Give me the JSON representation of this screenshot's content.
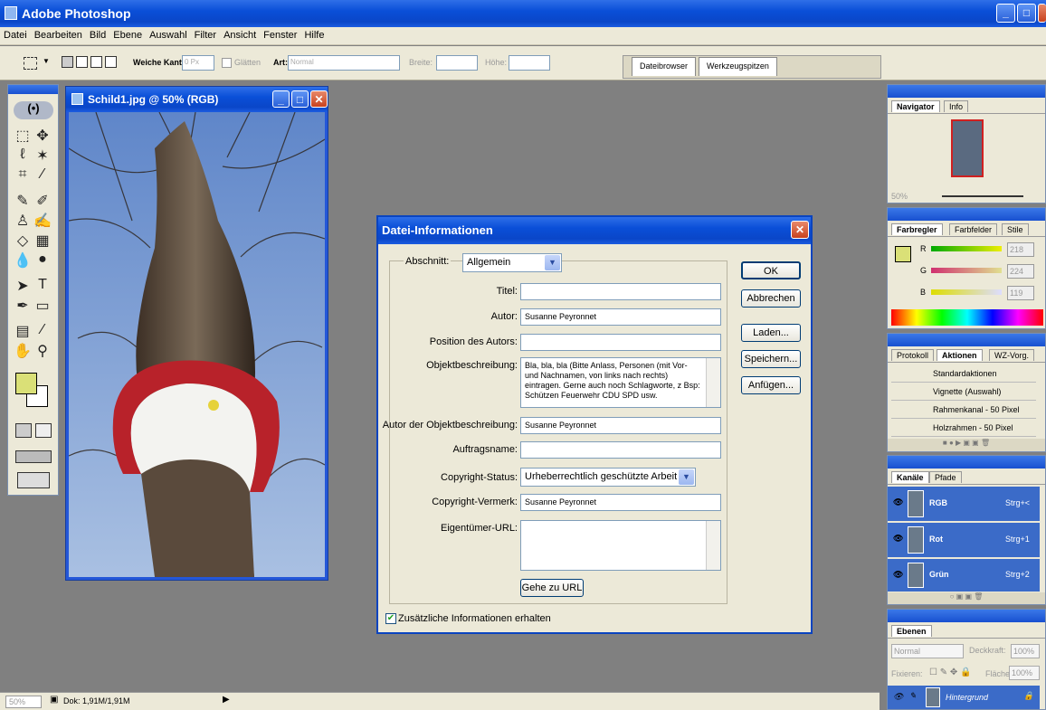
{
  "app": {
    "title": "Adobe Photoshop"
  },
  "menu": [
    "Datei",
    "Bearbeiten",
    "Bild",
    "Ebene",
    "Auswahl",
    "Filter",
    "Ansicht",
    "Fenster",
    "Hilfe"
  ],
  "options": {
    "feather_label": "Weiche Kante:",
    "feather_value": "0 Px",
    "antialias_label": "Glätten",
    "style_label": "Art:",
    "style_value": "Normal",
    "width_label": "Breite:",
    "height_label": "Höhe:",
    "tab_filebrowser": "Dateibrowser",
    "tab_toolpresets": "Werkzeugspitzen"
  },
  "document": {
    "title": "Schild1.jpg @ 50% (RGB)"
  },
  "status": {
    "zoom": "50%",
    "doc": "Dok: 1,91M/1,91M"
  },
  "dialog": {
    "title": "Datei-Informationen",
    "section_label": "Abschnitt:",
    "section_value": "Allgemein",
    "fields": {
      "title_label": "Titel:",
      "title_value": "",
      "author_label": "Autor:",
      "author_value": "Susanne Peyronnet",
      "position_label": "Position des Autors:",
      "position_value": "",
      "desc_label": "Objektbeschreibung:",
      "desc_value": "Bla, bla, bla (Bitte Anlass, Personen (mit Vor- und Nachnamen, von links nach rechts) eintragen. Gerne auch noch Schlagworte, z Bsp: Schützen Feuerwehr CDU SPD usw.",
      "desc_author_label": "Autor der Objektbeschreibung:",
      "desc_author_value": "Susanne Peyronnet",
      "job_label": "Auftragsname:",
      "job_value": "",
      "copyright_status_label": "Copyright-Status:",
      "copyright_status_value": "Urheberrechtlich geschützte Arbeit",
      "copyright_notice_label": "Copyright-Vermerk:",
      "copyright_notice_value": "Susanne Peyronnet",
      "owner_url_label": "Eigentümer-URL:",
      "owner_url_value": ""
    },
    "goto_url": "Gehe zu URL",
    "keep_info": "Zusätzliche Informationen erhalten",
    "buttons": {
      "ok": "OK",
      "cancel": "Abbrechen",
      "load": "Laden...",
      "save": "Speichern...",
      "append": "Anfügen..."
    }
  },
  "navigator": {
    "tabs": [
      "Navigator",
      "Info"
    ],
    "zoom": "50%"
  },
  "color": {
    "tabs": [
      "Farbregler",
      "Farbfelder",
      "Stile"
    ],
    "r": "218",
    "g": "224",
    "b": "119",
    "swatch": "#dae077"
  },
  "actions": {
    "tabs": [
      "Protokoll",
      "Aktionen",
      "WZ-Vorg."
    ],
    "items": [
      "Standardaktionen",
      "Vignette (Auswahl)",
      "Rahmenkanal - 50 Pixel",
      "Holzrahmen - 50 Pixel"
    ]
  },
  "channels": {
    "tabs": [
      "Kanäle",
      "Pfade"
    ],
    "items": [
      {
        "name": "RGB",
        "shortcut": "Strg+<"
      },
      {
        "name": "Rot",
        "shortcut": "Strg+1"
      },
      {
        "name": "Grün",
        "shortcut": "Strg+2"
      }
    ]
  },
  "layers": {
    "tabs": [
      "Ebenen"
    ],
    "blend": "Normal",
    "opacity_label": "Deckkraft:",
    "opacity": "100%",
    "lock_label": "Fixieren:",
    "fill_label": "Fläche",
    "fill": "100%",
    "layer_name": "Hintergrund"
  }
}
